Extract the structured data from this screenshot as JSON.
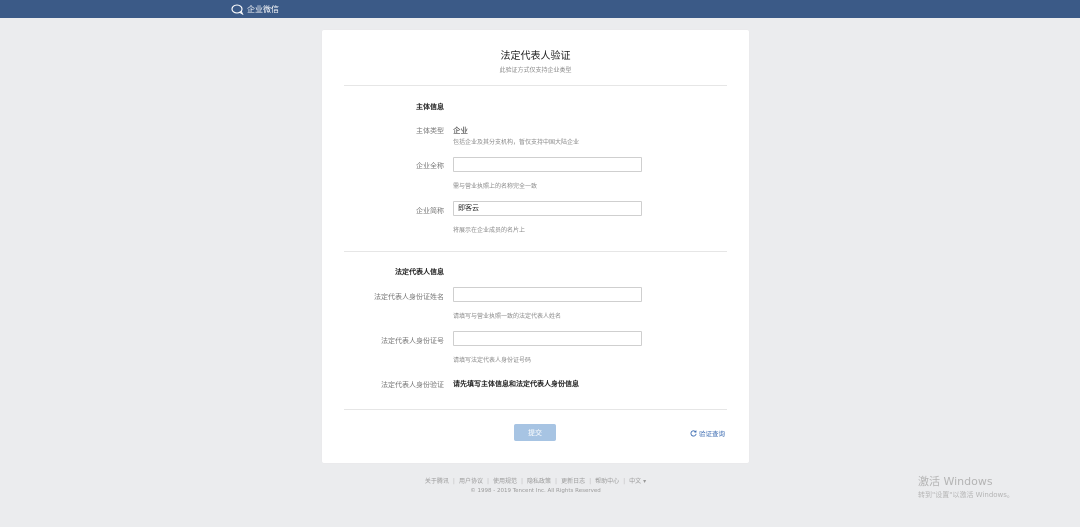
{
  "header": {
    "brand": "企业微信"
  },
  "form": {
    "title": "法定代表人验证",
    "subtitle": "此验证方式仅支持企业类型",
    "section_entity": "主体信息",
    "entity_type_label": "主体类型",
    "entity_type_value": "企业",
    "entity_type_hint": "包括企业及其分支机构，暂仅支持中国大陆企业",
    "full_name_label": "企业全称",
    "full_name_value": "",
    "full_name_hint": "需与营业执照上的名称完全一致",
    "short_name_label": "企业简称",
    "short_name_value": "即客云",
    "short_name_hint": "将展示在企业成员的名片上",
    "section_legal": "法定代表人信息",
    "legal_name_label": "法定代表人身份证姓名",
    "legal_name_value": "",
    "legal_name_hint": "请填写与营业执照一致的法定代表人姓名",
    "legal_id_label": "法定代表人身份证号",
    "legal_id_value": "",
    "legal_id_hint": "请填写法定代表人身份证号码",
    "legal_verify_label": "法定代表人身份验证",
    "legal_verify_value": "请先填写主体信息和法定代表人身份信息",
    "submit_label": "提交",
    "verify_query_label": "验证查询"
  },
  "footer": {
    "links": [
      "关于腾讯",
      "用户协议",
      "使用规范",
      "隐私政策",
      "更新日志",
      "帮助中心",
      "中文 ▾"
    ],
    "copyright": "© 1998 - 2019 Tencent Inc. All Rights Reserved"
  },
  "watermark": {
    "line1": "激活 Windows",
    "line2": "转到\"设置\"以激活 Windows。"
  },
  "colors": {
    "topbar": "#3b5a87",
    "submit": "#a7c4e3",
    "link": "#3b6bb1"
  }
}
